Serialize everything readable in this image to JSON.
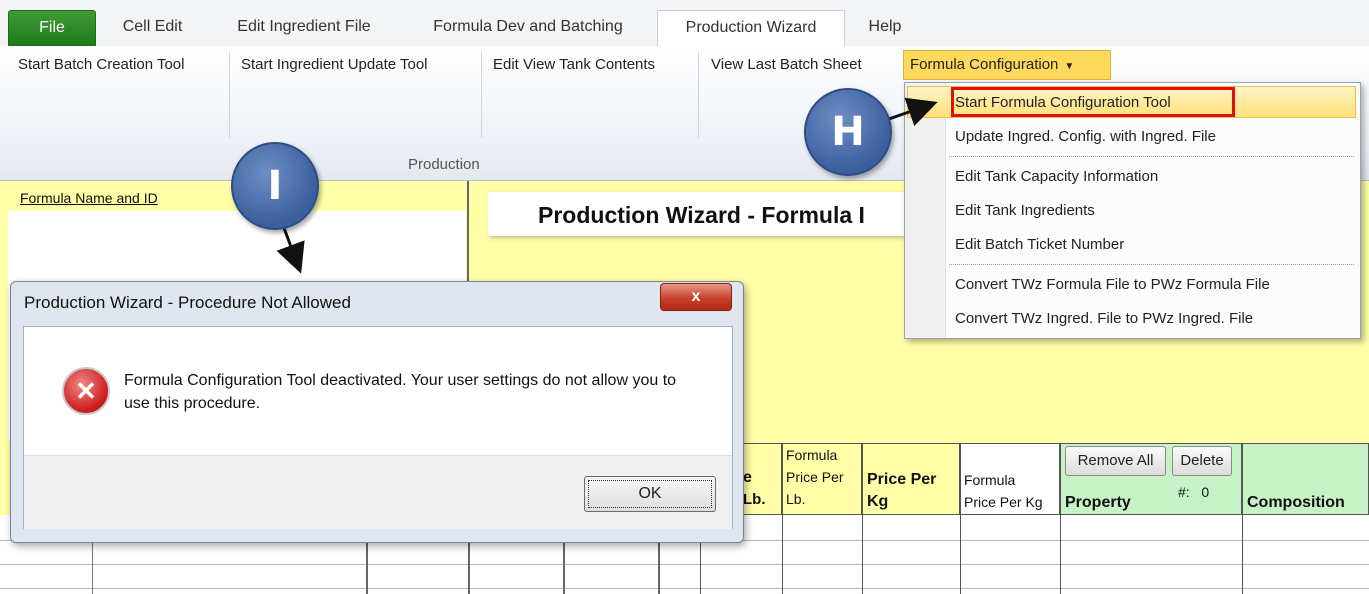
{
  "tabs": [
    {
      "label": "File"
    },
    {
      "label": "Cell Edit"
    },
    {
      "label": "Edit Ingredient File"
    },
    {
      "label": "Formula Dev and Batching"
    },
    {
      "label": "Production Wizard"
    },
    {
      "label": "Help"
    }
  ],
  "ribbon": {
    "buttons": [
      {
        "label": "Start Batch Creation Tool"
      },
      {
        "label": "Start Ingredient Update Tool"
      },
      {
        "label": "Edit View Tank Contents"
      },
      {
        "label": "View Last Batch Sheet"
      }
    ],
    "dropdown_label": "Formula Configuration",
    "group_label": "Production"
  },
  "menu": {
    "items": [
      {
        "label": "Start Formula Configuration Tool"
      },
      {
        "label": "Update Ingred. Config. with Ingred. File"
      },
      {
        "label": "Edit Tank Capacity Information"
      },
      {
        "label": "Edit Tank Ingredients"
      },
      {
        "label": "Edit Batch Ticket Number"
      },
      {
        "label": "Convert TWz Formula File to PWz Formula File"
      },
      {
        "label": "Convert TWz Ingred. File to PWz Ingred. File"
      }
    ]
  },
  "callouts": {
    "h": "H",
    "i": "I"
  },
  "sheet": {
    "formula_link": "Formula Name and ID",
    "banner": "Production Wizard - Formula I",
    "headers": {
      "col_e_top": "e",
      "col_e_bottom": "Lb.",
      "formula_price_lb": [
        "Formula",
        "Price Per",
        "Lb."
      ],
      "price_per_kg": [
        "Price Per",
        "Kg"
      ],
      "formula_price_kg": [
        "Formula",
        "Price Per Kg"
      ],
      "remove_all": "Remove All",
      "delete": "Delete",
      "count_label": "#:",
      "count_value": "0",
      "property": "Property",
      "composition": "Composition"
    }
  },
  "dialog": {
    "title": "Production Wizard - Procedure Not Allowed",
    "close_glyph": "x",
    "message": "Formula Configuration Tool deactivated. Your user settings do not allow you to use this procedure.",
    "ok_label": "OK"
  }
}
